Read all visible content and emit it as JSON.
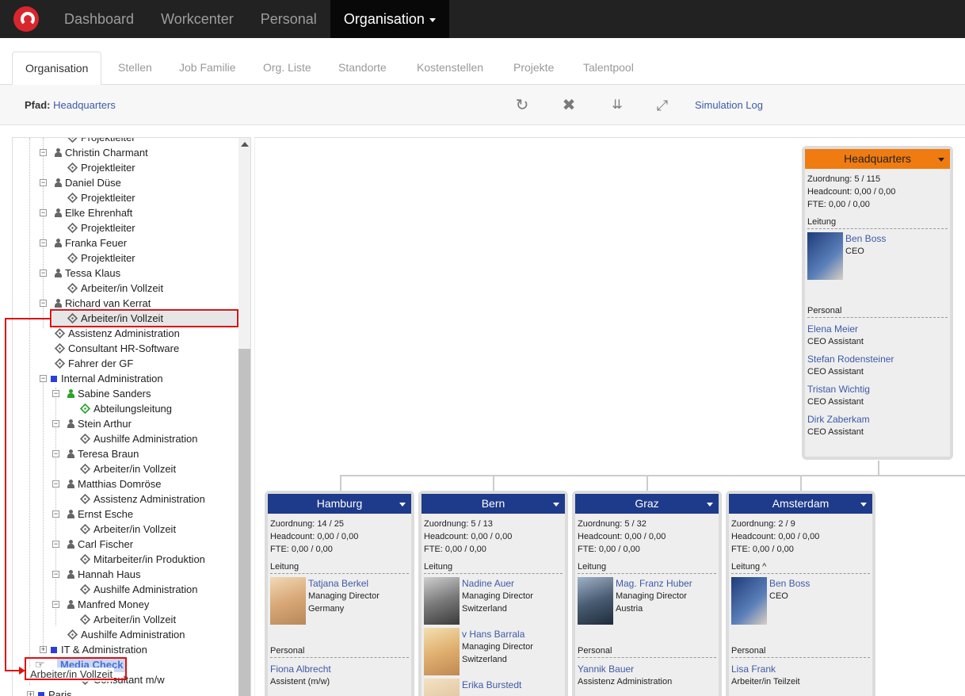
{
  "navbar": {
    "items": [
      "Dashboard",
      "Workcenter",
      "Personal",
      "Organisation"
    ]
  },
  "tabs": [
    "Organisation",
    "Stellen",
    "Job Familie",
    "Org. Liste",
    "Standorte",
    "Kostenstellen",
    "Projekte",
    "Talentpool"
  ],
  "pathbar": {
    "label": "Pfad:",
    "path": "Headquarters",
    "simulation_log": "Simulation Log"
  },
  "tree": {
    "nodes": [
      "Projektleiter",
      "Christin Charmant",
      "Projektleiter",
      "Daniel Düse",
      "Projektleiter",
      "Elke Ehrenhaft",
      "Projektleiter",
      "Franka Feuer",
      "Projektleiter",
      "Tessa Klaus",
      "Arbeiter/in Vollzeit",
      "Richard van Kerrat",
      "Arbeiter/in Vollzeit",
      "Assistenz Administration",
      "Consultant HR-Software",
      "Fahrer der GF",
      "Internal Administration",
      "Sabine Sanders",
      "Abteilungsleitung",
      "Stein Arthur",
      "Aushilfe Administration",
      "Teresa Braun",
      "Arbeiter/in Vollzeit",
      "Matthias Domröse",
      "Assistenz Administration",
      "Ernst Esche",
      "Arbeiter/in Vollzeit",
      "Carl Fischer",
      "Mitarbeiter/in Produktion",
      "Hannah Haus",
      "Aushilfe Administration",
      "Manfred Money",
      "Arbeiter/in Vollzeit",
      "Aushilfe Administration",
      "IT & Administration",
      "Media Check",
      "Consultant m/w",
      "Paris"
    ],
    "drag_label": "Arbeiter/in Vollzeit"
  },
  "headquarters": {
    "title": "Headquarters",
    "zuordnung": "Zuordnung: 5 / 115",
    "headcount": "Headcount: 0,00 / 0,00",
    "fte": "FTE: 0,00 / 0,00",
    "leitung_label": "Leitung",
    "leader": {
      "name": "Ben Boss",
      "role": "CEO"
    },
    "personal_label": "Personal",
    "staff": [
      {
        "name": "Elena Meier",
        "role": "CEO Assistant"
      },
      {
        "name": "Stefan Rodensteiner",
        "role": "CEO Assistant"
      },
      {
        "name": "Tristan Wichtig",
        "role": "CEO Assistant"
      },
      {
        "name": "Dirk Zaberkam",
        "role": "CEO Assistant"
      }
    ]
  },
  "units": [
    {
      "title": "Hamburg",
      "zuordnung": "Zuordnung: 14 / 25",
      "headcount": "Headcount: 0,00 / 0,00",
      "fte": "FTE: 0,00 / 0,00",
      "leitung_label": "Leitung",
      "leaders": [
        {
          "name": "Tatjana Berkel",
          "role": "Managing Director",
          "loc": "Germany"
        }
      ],
      "personal_label": "Personal",
      "staff": [
        {
          "name": "Fiona Albrecht",
          "role": "Assistent (m/w)"
        }
      ]
    },
    {
      "title": "Bern",
      "zuordnung": "Zuordnung: 5 / 13",
      "headcount": "Headcount: 0,00 / 0,00",
      "fte": "FTE: 0,00 / 0,00",
      "leitung_label": "Leitung",
      "leaders": [
        {
          "name": "Nadine Auer",
          "role": "Managing Director",
          "loc": "Switzerland"
        },
        {
          "name": "v Hans Barrala",
          "role": "Managing Director",
          "loc": "Switzerland"
        },
        {
          "name": "Erika Burstedt",
          "role": "",
          "loc": ""
        }
      ],
      "personal_label": "",
      "staff": []
    },
    {
      "title": "Graz",
      "zuordnung": "Zuordnung: 5 / 32",
      "headcount": "Headcount: 0,00 / 0,00",
      "fte": "FTE: 0,00 / 0,00",
      "leitung_label": "Leitung",
      "leaders": [
        {
          "name": "Mag. Franz Huber",
          "role": "Managing Director",
          "loc": "Austria"
        }
      ],
      "personal_label": "Personal",
      "staff": [
        {
          "name": "Yannik Bauer",
          "role": "Assistenz Administration"
        }
      ]
    },
    {
      "title": "Amsterdam",
      "zuordnung": "Zuordnung: 2 / 9",
      "headcount": "Headcount: 0,00 / 0,00",
      "fte": "FTE: 0,00 / 0,00",
      "leitung_label": "Leitung ^",
      "leaders": [
        {
          "name": "Ben Boss",
          "role": "CEO",
          "loc": ""
        }
      ],
      "personal_label": "Personal",
      "staff": [
        {
          "name": "Lisa Frank",
          "role": "Arbeiter/in Teilzeit"
        }
      ]
    }
  ],
  "colors": {
    "navbar": "#222222",
    "unit_header": "#1e3a8a",
    "root_header": "#f07b10",
    "link": "#3c5aa8",
    "annotation": "#e01010",
    "org_square": "#2b3fd6"
  }
}
